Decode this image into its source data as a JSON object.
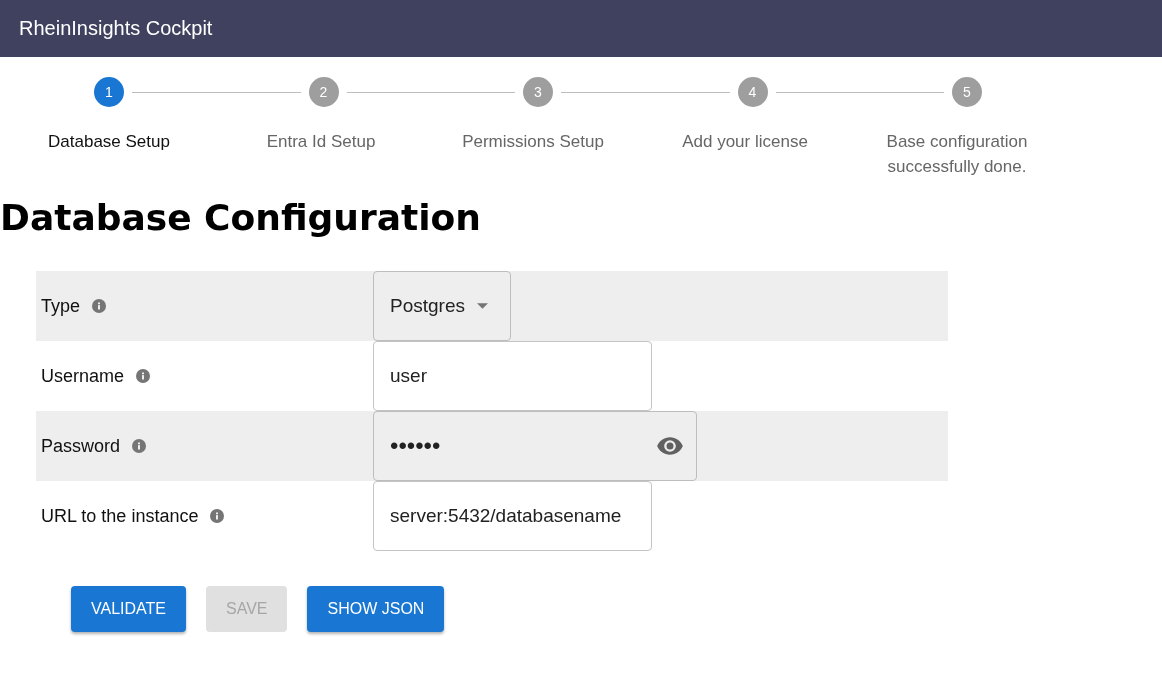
{
  "app_bar": {
    "title": "RheinInsights Cockpit"
  },
  "steps": [
    {
      "number": "1",
      "label": "Database Setup",
      "selected": true
    },
    {
      "number": "2",
      "label": "Entra Id Setup",
      "selected": false
    },
    {
      "number": "3",
      "label": "Permissions Setup",
      "selected": false
    },
    {
      "number": "4",
      "label": "Add your license",
      "selected": false
    },
    {
      "number": "5",
      "label": "Base configuration successfully done.",
      "selected": false
    }
  ],
  "heading": "Database Configuration",
  "fields": [
    {
      "kind": "select",
      "label": "Type",
      "value": "Postgres"
    },
    {
      "kind": "text",
      "label": "Username",
      "value": "user"
    },
    {
      "kind": "password",
      "label": "Password",
      "value": "••••••"
    },
    {
      "kind": "text",
      "label": "URL to the instance",
      "value": "server:5432/databasename"
    }
  ],
  "buttons": [
    {
      "label": "VALIDATE",
      "disabled": false
    },
    {
      "label": "SAVE",
      "disabled": true
    },
    {
      "label": "SHOW JSON",
      "disabled": false
    }
  ]
}
